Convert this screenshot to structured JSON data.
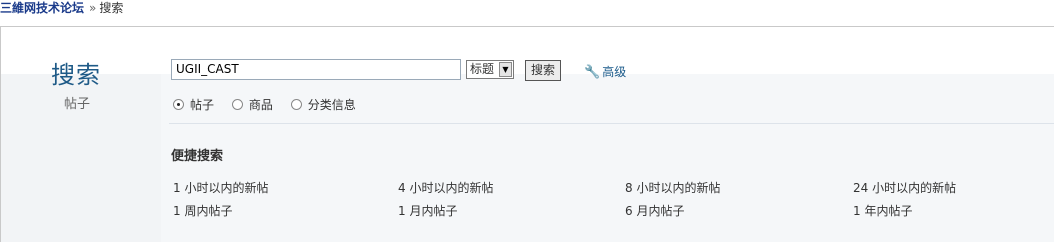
{
  "breadcrumb": {
    "site": "三維网技术论坛",
    "separator": "»",
    "current": "搜索"
  },
  "left": {
    "title": "搜索",
    "subtitle": "帖子"
  },
  "search": {
    "query": "UGII_CAST",
    "type_selected": "标题",
    "button": "搜索",
    "advanced": "高级"
  },
  "scope": [
    {
      "label": "帖子",
      "checked": true
    },
    {
      "label": "商品",
      "checked": false
    },
    {
      "label": "分类信息",
      "checked": false
    }
  ],
  "quick": {
    "title": "便捷搜索",
    "rows": [
      [
        "1 小时以内的新帖",
        "4 小时以内的新帖",
        "8 小时以内的新帖",
        "24 小时以内的新帖"
      ],
      [
        "1 周内帖子",
        "1 月内帖子",
        "6 月内帖子",
        "1 年内帖子"
      ]
    ]
  }
}
